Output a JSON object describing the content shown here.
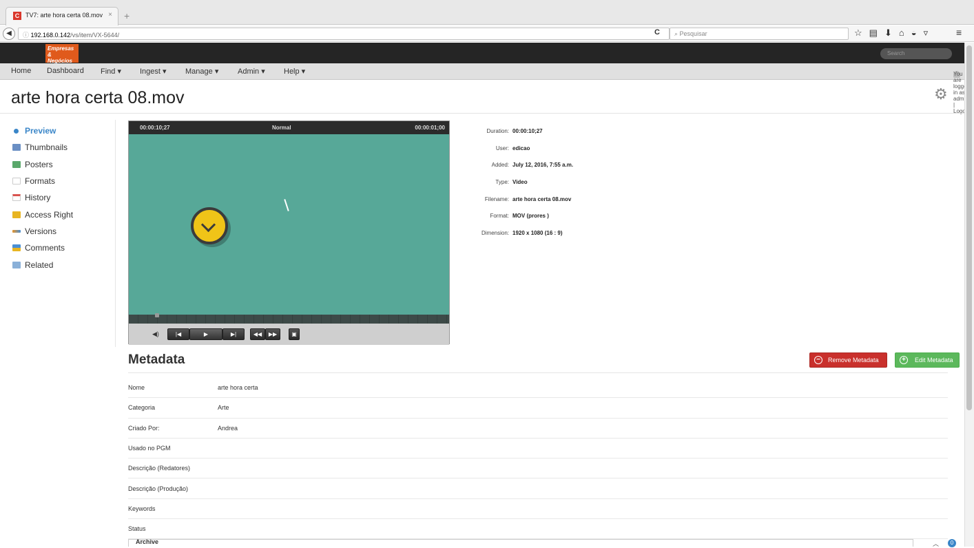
{
  "browser": {
    "tab_title": "TV7: arte hora certa 08.mov",
    "tab_favicon": "C",
    "tab_close": "×",
    "new_tab": "+",
    "url_host": "192.168.0.142",
    "url_path": "/vs/item/VX-5644/",
    "search_placeholder": "Pesquisar",
    "toolbar_icons": [
      "star-icon",
      "reading-list-icon",
      "download-icon",
      "home-icon",
      "sync-icon",
      "pocket-icon"
    ]
  },
  "brand": {
    "logo_line1": "Empresas",
    "logo_line2": "& Negócios",
    "search_placeholder": "Search"
  },
  "menu": {
    "items": [
      "Home",
      "Dashboard",
      "Find",
      "Ingest",
      "Manage",
      "Admin",
      "Help"
    ],
    "login_text": "You are logged in as admin | Logout"
  },
  "page": {
    "title": "arte hora certa 08.mov"
  },
  "sidebar": {
    "items": [
      {
        "label": "Preview",
        "icon": "bullet-icon",
        "color": "#3a86c8"
      },
      {
        "label": "Thumbnails",
        "icon": "thumbnails-icon",
        "color": "#6a8fc4"
      },
      {
        "label": "Posters",
        "icon": "posters-icon",
        "color": "#5aa86b"
      },
      {
        "label": "Formats",
        "icon": "formats-icon",
        "color": "#d8d8d8"
      },
      {
        "label": "History",
        "icon": "calendar-icon",
        "color": "#d9534f"
      },
      {
        "label": "Access Right",
        "icon": "lock-icon",
        "color": "#e8b522"
      },
      {
        "label": "Versions",
        "icon": "versions-icon",
        "color": "#e8952a"
      },
      {
        "label": "Comments",
        "icon": "comments-icon",
        "color": "#4a8fd4"
      },
      {
        "label": "Related",
        "icon": "related-icon",
        "color": "#8ab0d8"
      }
    ]
  },
  "player": {
    "time_left": "00:00:10;27",
    "speed": "Normal",
    "time_right": "00:00:01;00",
    "video_color": "#57a898"
  },
  "info": {
    "rows": [
      {
        "k": "Duration:",
        "v": "00:00:10;27"
      },
      {
        "k": "User:",
        "v": "edicao"
      },
      {
        "k": "Added:",
        "v": "July 12, 2016, 7:55 a.m."
      },
      {
        "k": "Type:",
        "v": "Video"
      },
      {
        "k": "Filename:",
        "v": "arte hora certa 08.mov"
      },
      {
        "k": "Format:",
        "v": "MOV (prores )"
      },
      {
        "k": "Dimension:",
        "v": "1920 x 1080 (16 : 9)"
      }
    ]
  },
  "metadata": {
    "title": "Metadata",
    "remove_label": "Remove Metadata",
    "edit_label": "Edit Metadata",
    "rows": [
      {
        "k": "Nome",
        "v": "arte hora certa"
      },
      {
        "k": "Categoria",
        "v": "Arte"
      },
      {
        "k": "Criado Por:",
        "v": "Andrea"
      },
      {
        "k": "Usado no PGM",
        "v": ""
      },
      {
        "k": "Descrição (Redatores)",
        "v": ""
      },
      {
        "k": "Descrição (Produção)",
        "v": ""
      },
      {
        "k": "Keywords",
        "v": ""
      },
      {
        "k": "Status",
        "v": ""
      }
    ],
    "archive_label": "Archive",
    "badge_count": "0"
  }
}
